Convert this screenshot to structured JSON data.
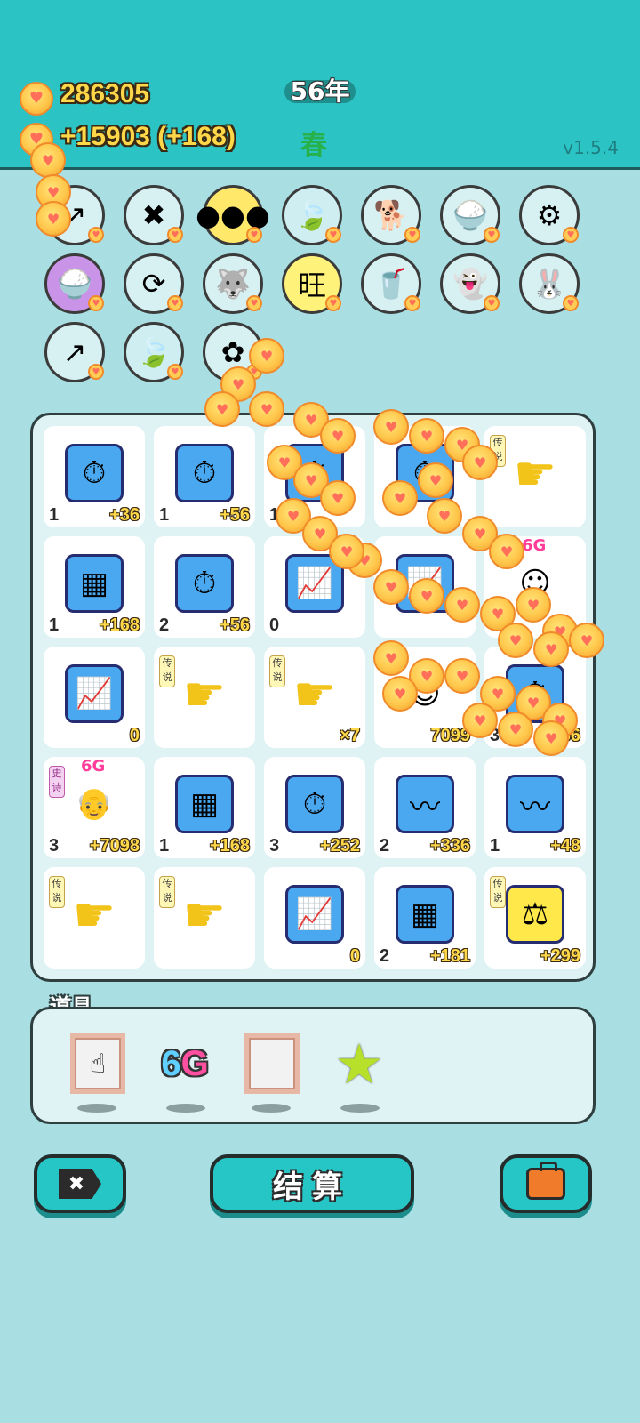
{
  "header": {
    "money": "286305",
    "income": "+15903 (+168)",
    "year": "56年",
    "season": "春",
    "version": "v1.5.4"
  },
  "tools": [
    {
      "icon": "arrow-up-icon"
    },
    {
      "icon": "close-tag-icon"
    },
    {
      "icon": "basketballs-icon"
    },
    {
      "icon": "leaf-icon"
    },
    {
      "icon": "dog-icon"
    },
    {
      "icon": "rice-bowl-icon"
    },
    {
      "icon": "pump-icon"
    },
    {
      "icon": "rice-bowl-icon"
    },
    {
      "icon": "refresh-icon"
    },
    {
      "icon": "husky-icon"
    },
    {
      "icon": "wang-grid-icon"
    },
    {
      "icon": "milk-tea-icon"
    },
    {
      "icon": "ghost-icon"
    },
    {
      "icon": "rabbit-icon"
    },
    {
      "icon": "arrow-up-icon"
    },
    {
      "icon": "leaf-icon"
    },
    {
      "icon": "flower-icon"
    }
  ],
  "grid": [
    {
      "icon": "stopwatch-icon",
      "count": "1",
      "value": "+36"
    },
    {
      "icon": "stopwatch-icon",
      "count": "1",
      "value": "+56"
    },
    {
      "icon": "stopwatch-icon",
      "count": "1",
      "value": ""
    },
    {
      "icon": "stopwatch-icon",
      "count": "",
      "value": ""
    },
    {
      "icon": "pointing-hand-icon",
      "count": "",
      "value": "",
      "tag": "传说"
    },
    {
      "icon": "gold-bars-icon",
      "count": "1",
      "value": "+168"
    },
    {
      "icon": "stopwatch-icon",
      "count": "2",
      "value": "+56"
    },
    {
      "icon": "chart-up-icon",
      "count": "0",
      "value": ""
    },
    {
      "icon": "chart-up-icon",
      "count": "",
      "value": ""
    },
    {
      "icon": "face-icon",
      "count": "",
      "value": "",
      "label6g": "6G"
    },
    {
      "icon": "chart-up-icon",
      "count": "",
      "value": "0"
    },
    {
      "icon": "pointing-hand-icon",
      "count": "",
      "value": "",
      "tag": "传说"
    },
    {
      "icon": "pointing-hand-icon",
      "count": "",
      "value": "×7",
      "tag": "传说"
    },
    {
      "icon": "face-icon",
      "count": "",
      "value": "7099"
    },
    {
      "icon": "stopwatch-icon",
      "count": "3",
      "value": "+36"
    },
    {
      "icon": "grandpa-icon",
      "count": "3",
      "value": "+7098",
      "tag": "史诗",
      "epic": true,
      "label6g": "6G"
    },
    {
      "icon": "gold-bars-icon",
      "count": "1",
      "value": "+168"
    },
    {
      "icon": "stopwatch-icon",
      "count": "3",
      "value": "+252"
    },
    {
      "icon": "trend-icon",
      "count": "2",
      "value": "+336"
    },
    {
      "icon": "trend-icon",
      "count": "1",
      "value": "+48"
    },
    {
      "icon": "pointing-hand-icon",
      "count": "",
      "value": "",
      "tag": "传说"
    },
    {
      "icon": "pointing-hand-icon",
      "count": "",
      "value": "",
      "tag": "传说"
    },
    {
      "icon": "chart-up-icon",
      "count": "",
      "value": "0"
    },
    {
      "icon": "gold-bars-icon",
      "count": "2",
      "value": "+181"
    },
    {
      "icon": "scales-icon",
      "count": "",
      "value": "+299",
      "tag": "传说"
    }
  ],
  "props_title": "道具",
  "props": [
    {
      "icon": "frame-hand-icon"
    },
    {
      "icon": "sixg-icon",
      "text_a": "6",
      "text_b": "G"
    },
    {
      "icon": "frame-empty-icon"
    },
    {
      "icon": "star-icon"
    }
  ],
  "buttons": {
    "close": "✖",
    "settle": "结算",
    "bag_icon": "briefcase-icon"
  }
}
